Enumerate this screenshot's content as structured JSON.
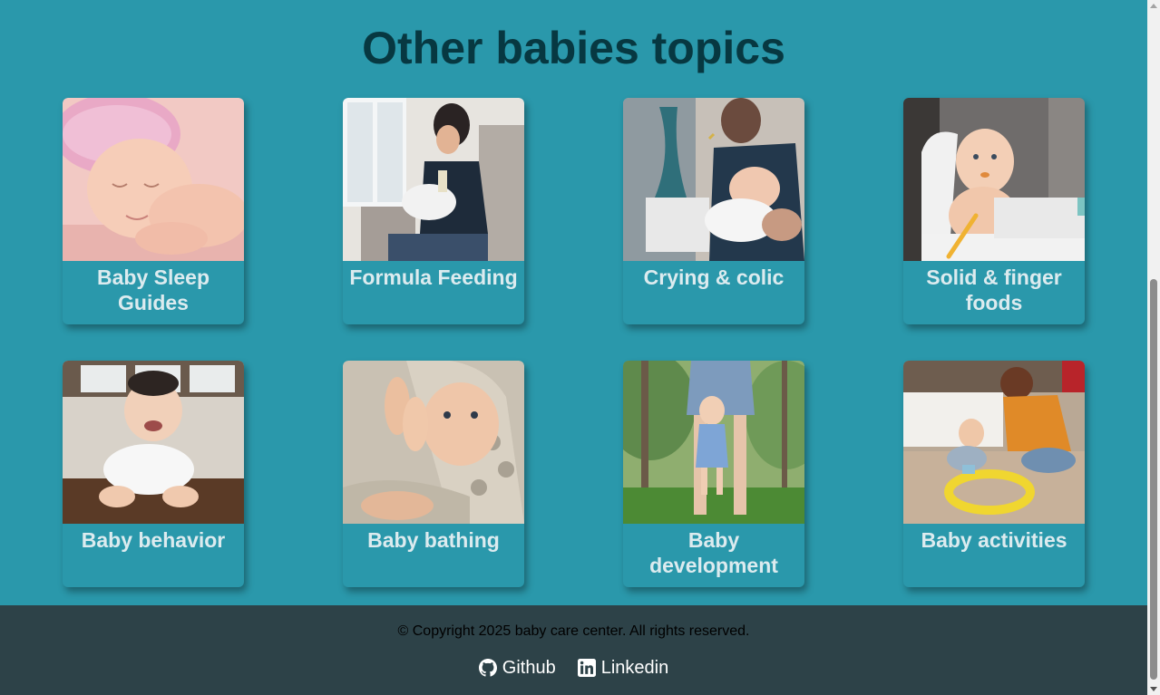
{
  "page": {
    "title": "Other babies topics"
  },
  "topics": [
    {
      "label": "Baby Sleep Guides",
      "image": "sleeping-baby-pink-hat"
    },
    {
      "label": "Formula Feeding",
      "image": "mother-bottle-feeding-baby"
    },
    {
      "label": "Crying & colic",
      "image": "father-holding-crying-baby"
    },
    {
      "label": "Solid & finger foods",
      "image": "baby-in-high-chair-with-spoon"
    },
    {
      "label": "Baby behavior",
      "image": "laughing-baby-on-floor"
    },
    {
      "label": "Baby bathing",
      "image": "baby-in-towel-clapping"
    },
    {
      "label": "Baby development",
      "image": "baby-learning-to-walk"
    },
    {
      "label": "Baby activities",
      "image": "mother-and-baby-playing-toy-track"
    }
  ],
  "footer": {
    "copyright": "© Copyright 2025 baby care center. All rights reserved.",
    "github_label": "Github",
    "linkedin_label": "Linkedin"
  },
  "colors": {
    "background": "#2a98ab",
    "title": "#073841",
    "card_text": "#dcebef",
    "footer": "#2d4248"
  }
}
